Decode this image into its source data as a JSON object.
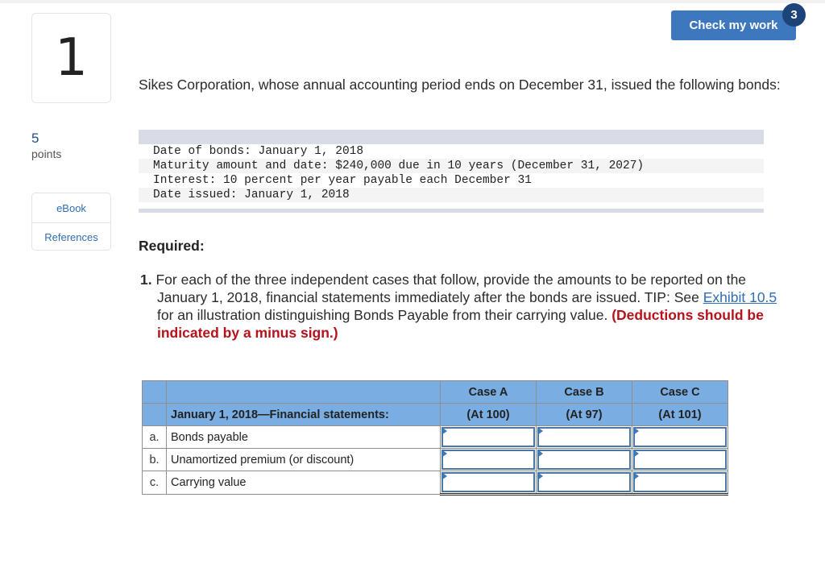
{
  "question": {
    "number": "1",
    "points_value": "5",
    "points_label": "points"
  },
  "resources": [
    {
      "label": "eBook"
    },
    {
      "label": "References"
    }
  ],
  "toolbar": {
    "check_label": "Check my work",
    "check_badge": "3"
  },
  "intro": "Sikes Corporation, whose annual accounting period ends on December 31, issued the following bonds:",
  "bond_data": [
    "Date of bonds: January 1, 2018",
    "Maturity amount and date: $240,000 due in 10 years (December 31, 2027)",
    "Interest: 10 percent per year payable each December 31",
    "Date issued: January 1, 2018"
  ],
  "required_label": "Required:",
  "instruction": {
    "number": "1.",
    "text_before_link": " For each of the three independent cases that follow, provide the amounts to be reported on the January 1, 2018, financial statements immediately after the bonds are issued. TIP: See ",
    "link_text": "Exhibit 10.5",
    "text_after_link": " for an illustration distinguishing Bonds Payable from their carrying value. ",
    "warning": "(Deductions should be indicated by a minus sign.)"
  },
  "worksheet": {
    "header_label": "January 1, 2018—Financial statements:",
    "columns": [
      {
        "title": "Case A",
        "subtitle": "(At 100)"
      },
      {
        "title": "Case B",
        "subtitle": "(At 97)"
      },
      {
        "title": "Case C",
        "subtitle": "(At 101)"
      }
    ],
    "rows": [
      {
        "letter": "a.",
        "label": "Bonds payable",
        "values": [
          "",
          "",
          ""
        ]
      },
      {
        "letter": "b.",
        "label": "Unamortized premium (or discount)",
        "values": [
          "",
          "",
          ""
        ]
      },
      {
        "letter": "c.",
        "label": "Carrying value",
        "values": [
          "",
          "",
          ""
        ]
      }
    ]
  }
}
